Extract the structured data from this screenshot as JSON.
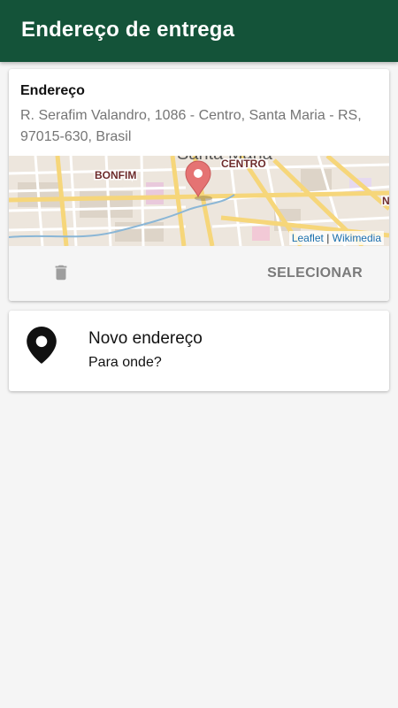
{
  "appbar": {
    "title": "Endereço de entrega",
    "color": "#145339"
  },
  "saved_address": {
    "label": "Endereço",
    "address": "R. Serafim Valandro, 1086 - Centro, Santa Maria - RS, 97015-630, Brasil",
    "map": {
      "labels": {
        "city": "Santa Maria",
        "district1": "BONFIM",
        "district2": "CENTRO",
        "edge": "N"
      },
      "attribution": {
        "leaflet": "Leaflet",
        "separator": "|",
        "wikimedia": "Wikimedia"
      },
      "marker_color": "#e57373"
    },
    "actions": {
      "delete_icon": "trash-icon",
      "select_label": "SELECIONAR"
    }
  },
  "new_address": {
    "icon": "location-pin-icon",
    "title": "Novo endereço",
    "subtitle": "Para onde?"
  }
}
